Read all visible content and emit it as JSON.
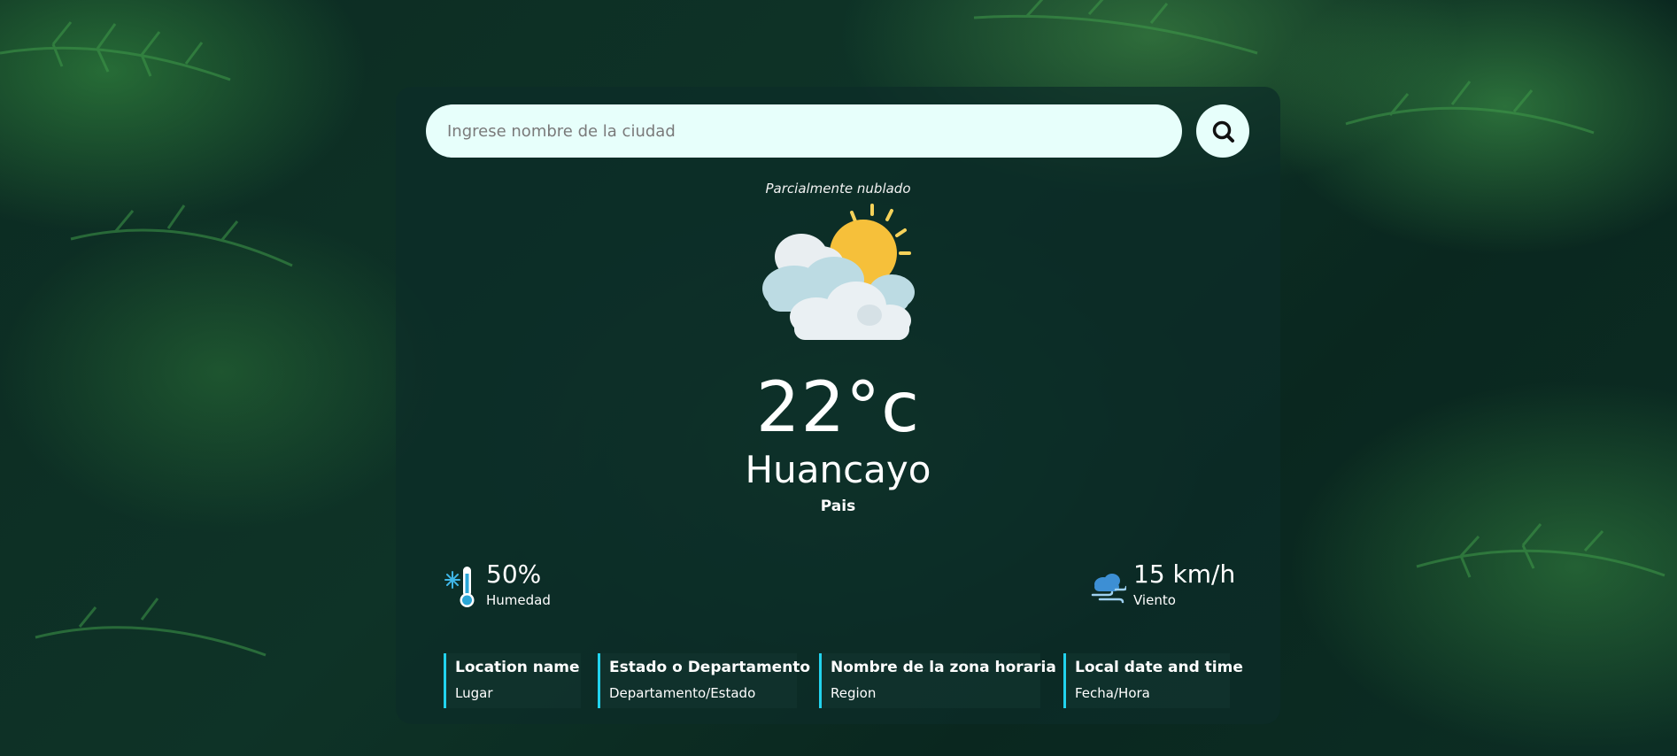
{
  "search": {
    "placeholder": "Ingrese nombre de la ciudad",
    "icon": "search-icon"
  },
  "weather": {
    "condition": "Parcialmente nublado",
    "icon": "partly-cloudy-icon",
    "temperature": "22°c",
    "city": "Huancayo",
    "country": "Pais"
  },
  "stats": {
    "humidity": {
      "value": "50%",
      "label": "Humedad",
      "icon": "thermometer-icon"
    },
    "wind": {
      "value": "15 km/h",
      "label": "Viento",
      "icon": "wind-cloud-icon"
    }
  },
  "info": [
    {
      "title": "Location name",
      "value": "Lugar"
    },
    {
      "title": "Estado o Departamento",
      "value": "Departamento/Estado"
    },
    {
      "title": "Nombre de la zona horaria",
      "value": "Region"
    },
    {
      "title": "Local date and time",
      "value": "Fecha/Hora"
    }
  ],
  "colors": {
    "accent": "#22d3ee",
    "input_bg": "#e7fffb",
    "card_bg": "#0c2c28",
    "sun": "#f6c03a"
  }
}
